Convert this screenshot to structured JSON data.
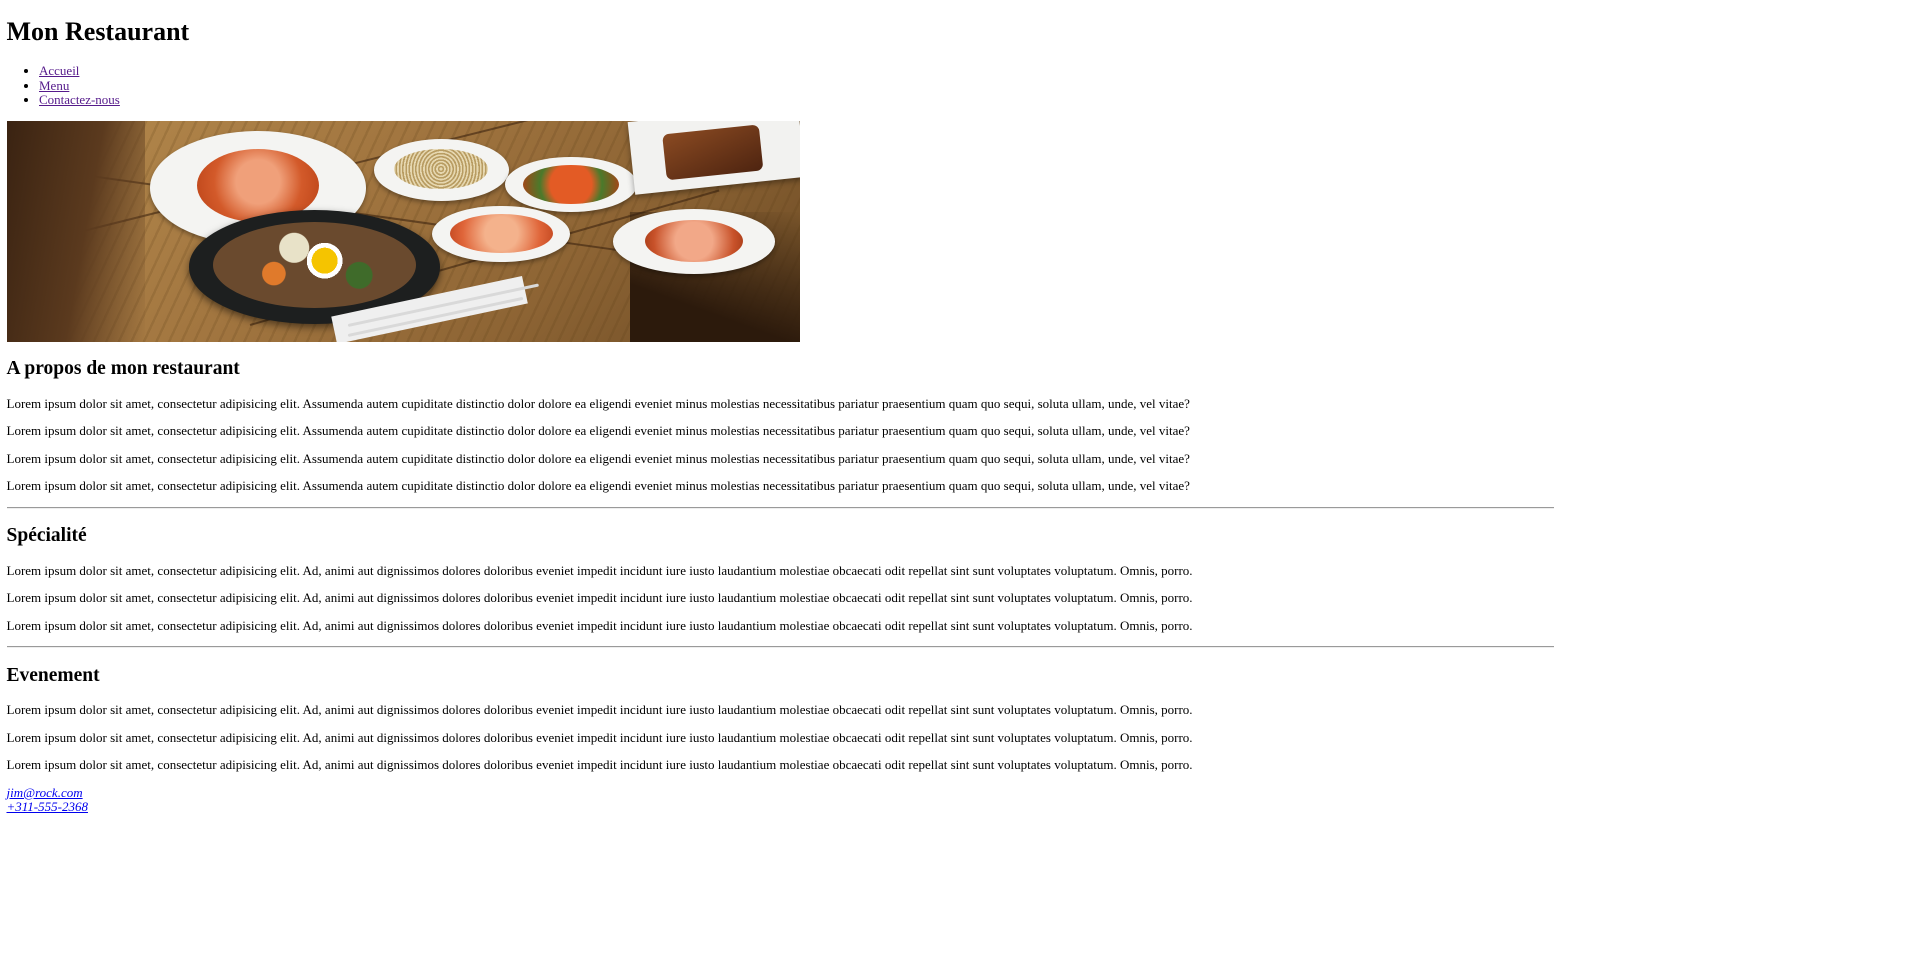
{
  "header": {
    "title": "Mon Restaurant"
  },
  "nav": {
    "items": [
      {
        "label": "Accueil"
      },
      {
        "label": "Menu"
      },
      {
        "label": "Contactez-nous"
      }
    ]
  },
  "hero": {
    "description": "Korean dishes on wooden table",
    "alt": "food"
  },
  "about": {
    "heading": "A propos de mon restaurant",
    "paragraphs": [
      "Lorem ipsum dolor sit amet, consectetur adipisicing elit. Assumenda autem cupiditate distinctio dolor dolore ea eligendi eveniet minus molestias necessitatibus pariatur praesentium quam quo sequi, soluta ullam, unde, vel vitae?",
      "Lorem ipsum dolor sit amet, consectetur adipisicing elit. Assumenda autem cupiditate distinctio dolor dolore ea eligendi eveniet minus molestias necessitatibus pariatur praesentium quam quo sequi, soluta ullam, unde, vel vitae?",
      "Lorem ipsum dolor sit amet, consectetur adipisicing elit. Assumenda autem cupiditate distinctio dolor dolore ea eligendi eveniet minus molestias necessitatibus pariatur praesentium quam quo sequi, soluta ullam, unde, vel vitae?",
      "Lorem ipsum dolor sit amet, consectetur adipisicing elit. Assumenda autem cupiditate distinctio dolor dolore ea eligendi eveniet minus molestias necessitatibus pariatur praesentium quam quo sequi, soluta ullam, unde, vel vitae?"
    ]
  },
  "specialty": {
    "heading": "Spécialité",
    "paragraphs": [
      "Lorem ipsum dolor sit amet, consectetur adipisicing elit. Ad, animi aut dignissimos dolores doloribus eveniet impedit incidunt iure iusto laudantium molestiae obcaecati odit repellat sint sunt voluptates voluptatum. Omnis, porro.",
      "Lorem ipsum dolor sit amet, consectetur adipisicing elit. Ad, animi aut dignissimos dolores doloribus eveniet impedit incidunt iure iusto laudantium molestiae obcaecati odit repellat sint sunt voluptates voluptatum. Omnis, porro.",
      "Lorem ipsum dolor sit amet, consectetur adipisicing elit. Ad, animi aut dignissimos dolores doloribus eveniet impedit incidunt iure iusto laudantium molestiae obcaecati odit repellat sint sunt voluptates voluptatum. Omnis, porro."
    ]
  },
  "event": {
    "heading": "Evenement",
    "paragraphs": [
      "Lorem ipsum dolor sit amet, consectetur adipisicing elit. Ad, animi aut dignissimos dolores doloribus eveniet impedit incidunt iure iusto laudantium molestiae obcaecati odit repellat sint sunt voluptates voluptatum. Omnis, porro.",
      "Lorem ipsum dolor sit amet, consectetur adipisicing elit. Ad, animi aut dignissimos dolores doloribus eveniet impedit incidunt iure iusto laudantium molestiae obcaecati odit repellat sint sunt voluptates voluptatum. Omnis, porro.",
      "Lorem ipsum dolor sit amet, consectetur adipisicing elit. Ad, animi aut dignissimos dolores doloribus eveniet impedit incidunt iure iusto laudantium molestiae obcaecati odit repellat sint sunt voluptates voluptatum. Omnis, porro."
    ]
  },
  "contact": {
    "email": "jim@rock.com",
    "phone": "+311-555-2368"
  },
  "colors": {
    "link": "#0000ee",
    "link_visited": "#551a8b",
    "text": "#000000",
    "background": "#ffffff"
  }
}
